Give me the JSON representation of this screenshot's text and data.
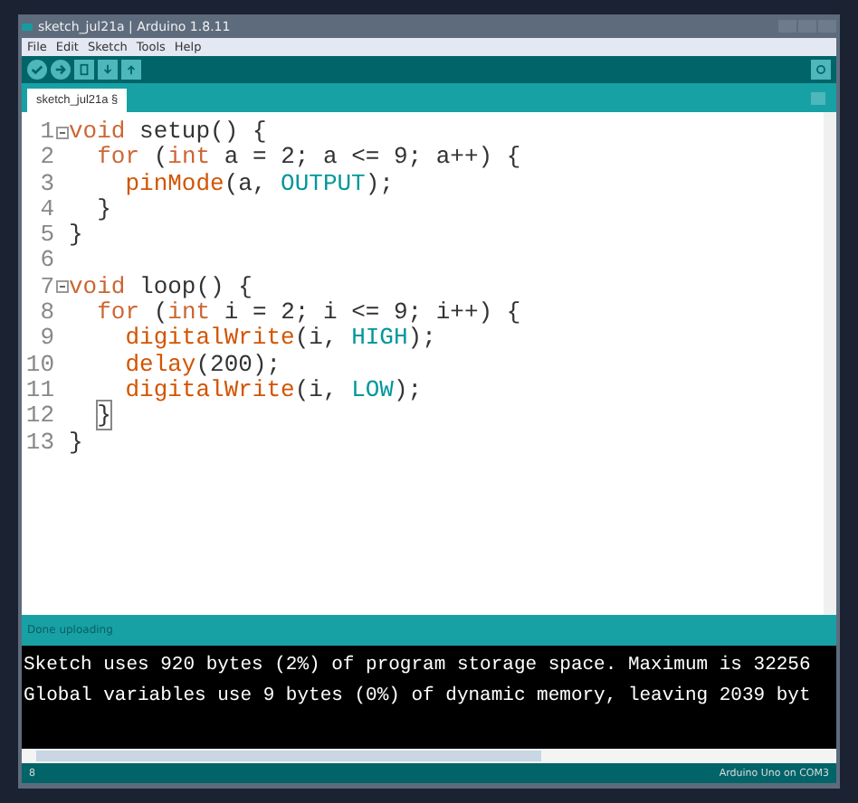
{
  "window": {
    "title": "sketch_jul21a | Arduino 1.8.11"
  },
  "menu": [
    "File",
    "Edit",
    "Sketch",
    "Tools",
    "Help"
  ],
  "tabs": [
    {
      "label": "sketch_jul21a §",
      "selected": true
    }
  ],
  "editor": {
    "lines": [
      {
        "number": "1",
        "fold": true,
        "tokens": [
          {
            "kind": "keyword",
            "text": "void"
          },
          {
            "kind": "plain",
            "text": " setup() {"
          }
        ]
      },
      {
        "number": "2",
        "fold": false,
        "tokens": [
          {
            "kind": "keyword",
            "text": "  for"
          },
          {
            "kind": "plain",
            "text": " ("
          },
          {
            "kind": "keyword",
            "text": "int"
          },
          {
            "kind": "plain",
            "text": " a = 2; a <= 9; a++) {"
          }
        ]
      },
      {
        "number": "3",
        "fold": false,
        "tokens": [
          {
            "kind": "function",
            "text": "    pinMode"
          },
          {
            "kind": "plain",
            "text": "(a, "
          },
          {
            "kind": "constant",
            "text": "OUTPUT"
          },
          {
            "kind": "plain",
            "text": ");"
          }
        ]
      },
      {
        "number": "4",
        "fold": false,
        "tokens": [
          {
            "kind": "plain",
            "text": "  }"
          }
        ]
      },
      {
        "number": "5",
        "fold": false,
        "tokens": [
          {
            "kind": "plain",
            "text": "}"
          }
        ]
      },
      {
        "number": "6",
        "fold": false
      },
      {
        "number": "7",
        "fold": true,
        "tokens": [
          {
            "kind": "keyword",
            "text": "void"
          },
          {
            "kind": "plain",
            "text": " loop() {"
          }
        ]
      },
      {
        "number": "8",
        "fold": false,
        "tokens": [
          {
            "kind": "keyword",
            "text": "  for"
          },
          {
            "kind": "plain",
            "text": " ("
          },
          {
            "kind": "keyword",
            "text": "int"
          },
          {
            "kind": "plain",
            "text": " i = 2; i <= 9; i++) {"
          }
        ]
      },
      {
        "number": "9",
        "fold": false,
        "tokens": [
          {
            "kind": "function",
            "text": "    digitalWrite"
          },
          {
            "kind": "plain",
            "text": "(i, "
          },
          {
            "kind": "constant",
            "text": "HIGH"
          },
          {
            "kind": "plain",
            "text": ");"
          }
        ]
      },
      {
        "number": "10",
        "fold": false,
        "tokens": [
          {
            "kind": "function",
            "text": "    delay"
          },
          {
            "kind": "plain",
            "text": "(200);"
          }
        ]
      },
      {
        "number": "11",
        "fold": false,
        "tokens": [
          {
            "kind": "function",
            "text": "    digitalWrite"
          },
          {
            "kind": "plain",
            "text": "(i, "
          },
          {
            "kind": "constant",
            "text": "LOW"
          },
          {
            "kind": "plain",
            "text": ");"
          }
        ]
      },
      {
        "number": "12",
        "fold": false,
        "tokens": [
          {
            "kind": "matched-bracket",
            "text": "  }"
          }
        ]
      },
      {
        "number": "13",
        "fold": false,
        "tokens": [
          {
            "kind": "plain",
            "text": "}"
          }
        ]
      }
    ]
  },
  "status": "Done uploading",
  "console": [
    "Sketch uses 920 bytes (2%) of program storage space. Maximum is 32256",
    "Global variables use 9 bytes (0%) of dynamic memory, leaving 2039 byt"
  ],
  "status_bar": {
    "line": "8",
    "board": "Arduino Uno on COM3"
  }
}
